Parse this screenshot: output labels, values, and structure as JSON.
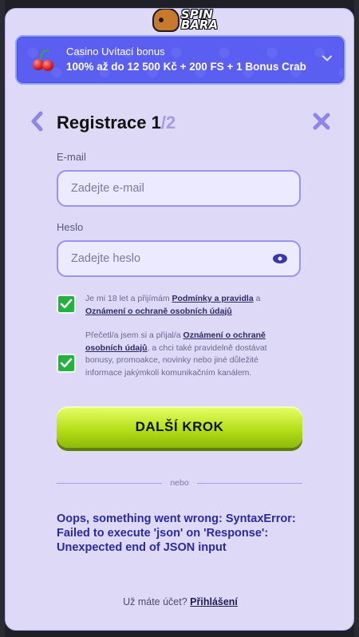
{
  "logo": {
    "line1": "SPIN",
    "line2": "BARA"
  },
  "bonus": {
    "title": "Casino Uvítací bonus",
    "detail": "100% až do 12 500 Kč + 200 FS + 1 Bonus Crab"
  },
  "header": {
    "title_main": "Registrace 1",
    "title_sep": "/2"
  },
  "form": {
    "email_label": "E-mail",
    "email_placeholder": "Zadejte e-mail",
    "password_label": "Heslo",
    "password_placeholder": "Zadejte heslo"
  },
  "consents": [
    {
      "checked": true,
      "text_before": "Je mi 18 let a přijímám ",
      "link1": "Podmínky a pravidla",
      "text_mid": " a ",
      "link2": "Oznámení o ochraně osobních údajů"
    },
    {
      "checked": true,
      "text_before": "Přečetl/a jsem si a přijal/a ",
      "link1": "Oznámení o ochraně osobních údajů",
      "text_after": ", a chci také pravidelně dostávat bonusy, promoakce, novinky nebo jiné důležité informace jakýmkoli komunikačním kanálem."
    }
  ],
  "cta": {
    "label": "DALŠÍ KROK"
  },
  "divider": {
    "label": "nebo"
  },
  "error": {
    "message": "Oops, something went wrong: SyntaxError: Failed to execute 'json' on 'Response': Unexpected end of JSON input"
  },
  "footer": {
    "prompt": "Už máte účet? ",
    "login_link": "Přihlášení"
  },
  "colors": {
    "bonus_bg": "#5b5ff1",
    "modal_bg": "#ddd9f7",
    "cta_green": "#b5e01a",
    "check_green": "#23b23f",
    "error_text": "#2b2aa1"
  },
  "icons": [
    "cherry-icon",
    "chevron-down-icon",
    "back-arrow-icon",
    "close-icon",
    "eye-icon",
    "check-icon"
  ]
}
